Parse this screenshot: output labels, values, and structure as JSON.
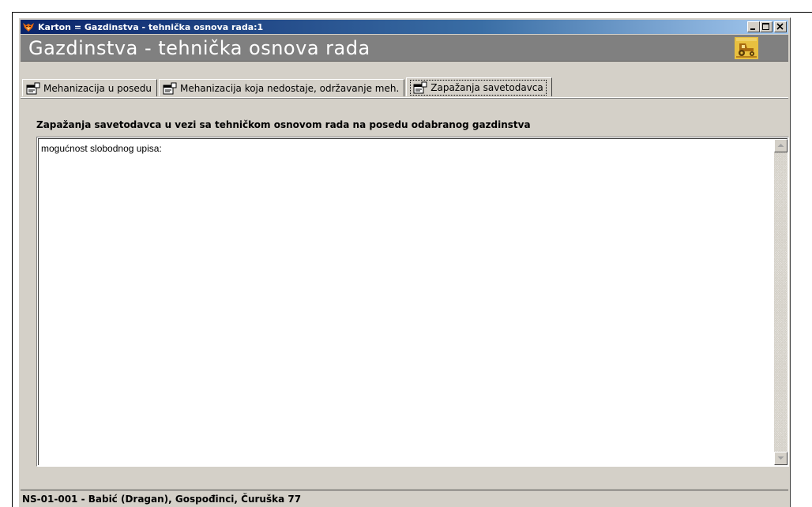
{
  "window": {
    "title": "Karton = Gazdinstva - tehnička osnova rada:1",
    "header_title": "Gazdinstva - tehnička osnova rada",
    "icon": "fox-app-icon",
    "controls": [
      "minimize",
      "maximize",
      "close"
    ]
  },
  "tabs": [
    {
      "label": "Mehanizacija u posedu",
      "icon": "form-icon",
      "active": false
    },
    {
      "label": "Mehanizacija koja nedostaje, održavanje meh.",
      "icon": "form-icon",
      "active": false
    },
    {
      "label": "Zapažanja savetodavca",
      "icon": "form-icon",
      "active": true
    }
  ],
  "content": {
    "section_label": "Zapažanja savetodavca u vezi sa tehničkom osnovom rada na posedu odabranog gazdinstva",
    "memo_text": "mogućnost slobodnog upisa:"
  },
  "statusbar": {
    "text": "NS-01-001 - Babić (Dragan), Gospođinci, Čuruška 77"
  },
  "colors": {
    "titlebar_start": "#0a246a",
    "titlebar_end": "#a6caf0",
    "header_band": "#808080",
    "face": "#d4d0c8"
  }
}
